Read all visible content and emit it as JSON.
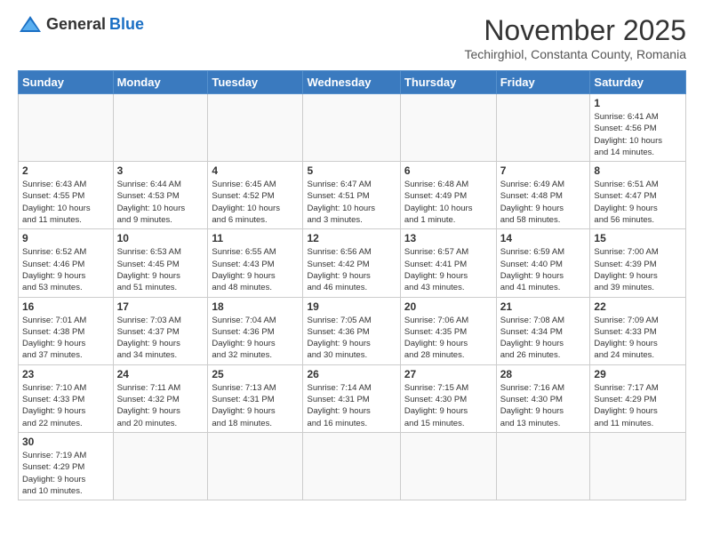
{
  "header": {
    "logo_general": "General",
    "logo_blue": "Blue",
    "month_title": "November 2025",
    "location": "Techirghiol, Constanta County, Romania"
  },
  "days_of_week": [
    "Sunday",
    "Monday",
    "Tuesday",
    "Wednesday",
    "Thursday",
    "Friday",
    "Saturday"
  ],
  "weeks": [
    [
      {
        "day": "",
        "info": ""
      },
      {
        "day": "",
        "info": ""
      },
      {
        "day": "",
        "info": ""
      },
      {
        "day": "",
        "info": ""
      },
      {
        "day": "",
        "info": ""
      },
      {
        "day": "",
        "info": ""
      },
      {
        "day": "1",
        "info": "Sunrise: 6:41 AM\nSunset: 4:56 PM\nDaylight: 10 hours\nand 14 minutes."
      }
    ],
    [
      {
        "day": "2",
        "info": "Sunrise: 6:43 AM\nSunset: 4:55 PM\nDaylight: 10 hours\nand 11 minutes."
      },
      {
        "day": "3",
        "info": "Sunrise: 6:44 AM\nSunset: 4:53 PM\nDaylight: 10 hours\nand 9 minutes."
      },
      {
        "day": "4",
        "info": "Sunrise: 6:45 AM\nSunset: 4:52 PM\nDaylight: 10 hours\nand 6 minutes."
      },
      {
        "day": "5",
        "info": "Sunrise: 6:47 AM\nSunset: 4:51 PM\nDaylight: 10 hours\nand 3 minutes."
      },
      {
        "day": "6",
        "info": "Sunrise: 6:48 AM\nSunset: 4:49 PM\nDaylight: 10 hours\nand 1 minute."
      },
      {
        "day": "7",
        "info": "Sunrise: 6:49 AM\nSunset: 4:48 PM\nDaylight: 9 hours\nand 58 minutes."
      },
      {
        "day": "8",
        "info": "Sunrise: 6:51 AM\nSunset: 4:47 PM\nDaylight: 9 hours\nand 56 minutes."
      }
    ],
    [
      {
        "day": "9",
        "info": "Sunrise: 6:52 AM\nSunset: 4:46 PM\nDaylight: 9 hours\nand 53 minutes."
      },
      {
        "day": "10",
        "info": "Sunrise: 6:53 AM\nSunset: 4:45 PM\nDaylight: 9 hours\nand 51 minutes."
      },
      {
        "day": "11",
        "info": "Sunrise: 6:55 AM\nSunset: 4:43 PM\nDaylight: 9 hours\nand 48 minutes."
      },
      {
        "day": "12",
        "info": "Sunrise: 6:56 AM\nSunset: 4:42 PM\nDaylight: 9 hours\nand 46 minutes."
      },
      {
        "day": "13",
        "info": "Sunrise: 6:57 AM\nSunset: 4:41 PM\nDaylight: 9 hours\nand 43 minutes."
      },
      {
        "day": "14",
        "info": "Sunrise: 6:59 AM\nSunset: 4:40 PM\nDaylight: 9 hours\nand 41 minutes."
      },
      {
        "day": "15",
        "info": "Sunrise: 7:00 AM\nSunset: 4:39 PM\nDaylight: 9 hours\nand 39 minutes."
      }
    ],
    [
      {
        "day": "16",
        "info": "Sunrise: 7:01 AM\nSunset: 4:38 PM\nDaylight: 9 hours\nand 37 minutes."
      },
      {
        "day": "17",
        "info": "Sunrise: 7:03 AM\nSunset: 4:37 PM\nDaylight: 9 hours\nand 34 minutes."
      },
      {
        "day": "18",
        "info": "Sunrise: 7:04 AM\nSunset: 4:36 PM\nDaylight: 9 hours\nand 32 minutes."
      },
      {
        "day": "19",
        "info": "Sunrise: 7:05 AM\nSunset: 4:36 PM\nDaylight: 9 hours\nand 30 minutes."
      },
      {
        "day": "20",
        "info": "Sunrise: 7:06 AM\nSunset: 4:35 PM\nDaylight: 9 hours\nand 28 minutes."
      },
      {
        "day": "21",
        "info": "Sunrise: 7:08 AM\nSunset: 4:34 PM\nDaylight: 9 hours\nand 26 minutes."
      },
      {
        "day": "22",
        "info": "Sunrise: 7:09 AM\nSunset: 4:33 PM\nDaylight: 9 hours\nand 24 minutes."
      }
    ],
    [
      {
        "day": "23",
        "info": "Sunrise: 7:10 AM\nSunset: 4:33 PM\nDaylight: 9 hours\nand 22 minutes."
      },
      {
        "day": "24",
        "info": "Sunrise: 7:11 AM\nSunset: 4:32 PM\nDaylight: 9 hours\nand 20 minutes."
      },
      {
        "day": "25",
        "info": "Sunrise: 7:13 AM\nSunset: 4:31 PM\nDaylight: 9 hours\nand 18 minutes."
      },
      {
        "day": "26",
        "info": "Sunrise: 7:14 AM\nSunset: 4:31 PM\nDaylight: 9 hours\nand 16 minutes."
      },
      {
        "day": "27",
        "info": "Sunrise: 7:15 AM\nSunset: 4:30 PM\nDaylight: 9 hours\nand 15 minutes."
      },
      {
        "day": "28",
        "info": "Sunrise: 7:16 AM\nSunset: 4:30 PM\nDaylight: 9 hours\nand 13 minutes."
      },
      {
        "day": "29",
        "info": "Sunrise: 7:17 AM\nSunset: 4:29 PM\nDaylight: 9 hours\nand 11 minutes."
      }
    ],
    [
      {
        "day": "30",
        "info": "Sunrise: 7:19 AM\nSunset: 4:29 PM\nDaylight: 9 hours\nand 10 minutes."
      },
      {
        "day": "",
        "info": ""
      },
      {
        "day": "",
        "info": ""
      },
      {
        "day": "",
        "info": ""
      },
      {
        "day": "",
        "info": ""
      },
      {
        "day": "",
        "info": ""
      },
      {
        "day": "",
        "info": ""
      }
    ]
  ]
}
